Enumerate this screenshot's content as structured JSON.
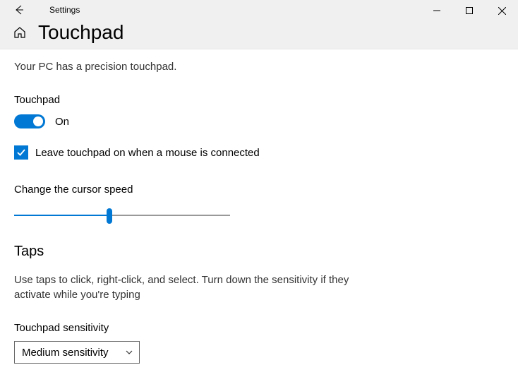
{
  "titlebar": {
    "app_title": "Settings",
    "page_heading": "Touchpad"
  },
  "content": {
    "info_text": "Your PC has a precision touchpad.",
    "touchpad_section_label": "Touchpad",
    "toggle_state_label": "On",
    "checkbox_label": "Leave touchpad on when a mouse is connected",
    "cursor_speed_label": "Change the cursor speed",
    "taps_heading": "Taps",
    "taps_desc": "Use taps to click, right-click, and select. Turn down the sensitivity if they activate while you're typing",
    "sensitivity_label": "Touchpad sensitivity",
    "sensitivity_value": "Medium sensitivity"
  }
}
